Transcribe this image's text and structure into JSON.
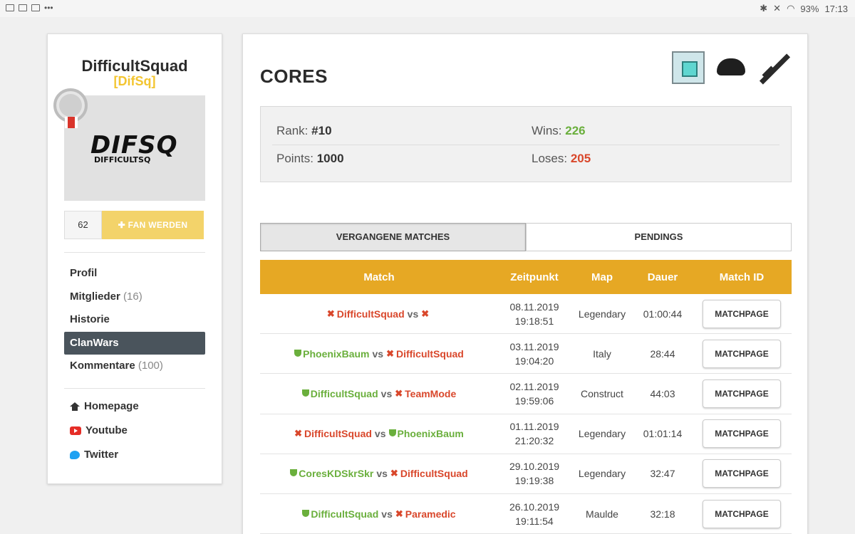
{
  "status_bar": {
    "battery": "93%",
    "time": "17:13"
  },
  "sidebar": {
    "clan_name": "DifficultSquad",
    "clan_tag": "[DifSq]",
    "logo_text": "DIFSQ",
    "logo_sub": "DIFFICULTSQ",
    "fan_count": "62",
    "fan_button": "FAN WERDEN",
    "nav": [
      {
        "label": "Profil",
        "count": ""
      },
      {
        "label": "Mitglieder",
        "count": "(16)"
      },
      {
        "label": "Historie",
        "count": ""
      },
      {
        "label": "ClanWars",
        "count": ""
      },
      {
        "label": "Kommentare",
        "count": "(100)"
      }
    ],
    "links": [
      {
        "label": "Homepage",
        "icon": "home-icon"
      },
      {
        "label": "Youtube",
        "icon": "youtube-icon"
      },
      {
        "label": "Twitter",
        "icon": "twitter-icon"
      }
    ]
  },
  "main": {
    "title": "CORES",
    "stats": {
      "rank_label": "Rank:",
      "rank_value": "#10",
      "points_label": "Points:",
      "points_value": "1000",
      "wins_label": "Wins:",
      "wins_value": "226",
      "loses_label": "Loses:",
      "loses_value": "205"
    },
    "tabs": [
      "VERGANGENE MATCHES",
      "PENDINGS"
    ],
    "table": {
      "headers": [
        "Match",
        "Zeitpunkt",
        "Map",
        "Dauer",
        "Match ID"
      ],
      "button_label": "MATCHPAGE",
      "rows": [
        {
          "team1": "DifficultSquad",
          "team1_result": "lose",
          "team2": "",
          "team2_result": "lose",
          "date": "08.11.2019",
          "time": "19:18:51",
          "map": "Legendary",
          "duration": "01:00:44"
        },
        {
          "team1": "PhoenixBaum",
          "team1_result": "win",
          "team2": "DifficultSquad",
          "team2_result": "lose",
          "date": "03.11.2019",
          "time": "19:04:20",
          "map": "Italy",
          "duration": "28:44"
        },
        {
          "team1": "DifficultSquad",
          "team1_result": "win",
          "team2": "TeamMode",
          "team2_result": "lose",
          "date": "02.11.2019",
          "time": "19:59:06",
          "map": "Construct",
          "duration": "44:03"
        },
        {
          "team1": "DifficultSquad",
          "team1_result": "lose",
          "team2": "PhoenixBaum",
          "team2_result": "win",
          "date": "01.11.2019",
          "time": "21:20:32",
          "map": "Legendary",
          "duration": "01:01:14"
        },
        {
          "team1": "CoresKDSkrSkr",
          "team1_result": "win",
          "team2": "DifficultSquad",
          "team2_result": "lose",
          "date": "29.10.2019",
          "time": "19:19:38",
          "map": "Legendary",
          "duration": "32:47"
        },
        {
          "team1": "DifficultSquad",
          "team1_result": "win",
          "team2": "Paramedic",
          "team2_result": "lose",
          "date": "26.10.2019",
          "time": "19:11:54",
          "map": "Maulde",
          "duration": "32:18"
        }
      ]
    }
  }
}
